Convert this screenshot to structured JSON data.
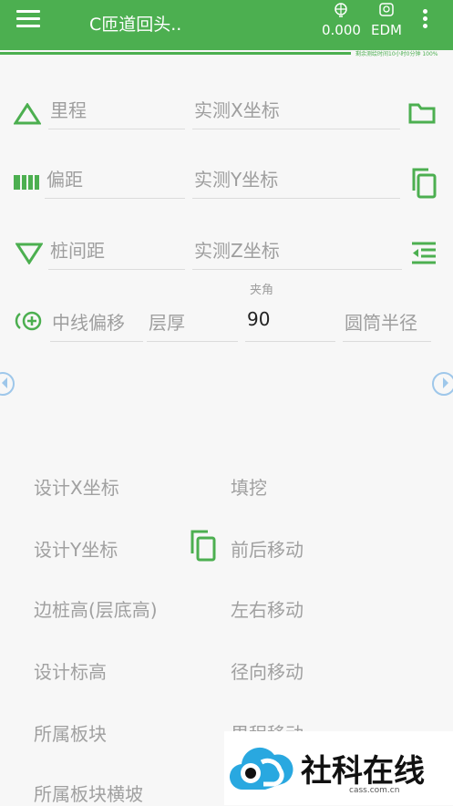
{
  "header": {
    "title": "C匝道回头..",
    "value": "0.000",
    "edm": "EDM",
    "remaining": "剩余测绘时间10小时0分钟 100%"
  },
  "inputs": {
    "mileage": "里程",
    "measured_x": "实测X坐标",
    "offset": "偏距",
    "measured_y": "实测Y坐标",
    "pile_spacing": "桩间距",
    "measured_z": "实测Z坐标",
    "centerline_offset": "中线偏移",
    "layer_thickness": "层厚",
    "angle_label": "夹角",
    "angle_value": "90",
    "cylinder_radius": "圆筒半径"
  },
  "results": {
    "design_x": "设计X坐标",
    "fill_cut": "填挖",
    "design_y": "设计Y坐标",
    "front_back": "前后移动",
    "edge_pile_height": "边桩高(层底高)",
    "left_right": "左右移动",
    "design_elevation": "设计标高",
    "radial": "径向移动",
    "plate": "所属板块",
    "mileage_move": "里程移动",
    "plate_slope": "所属板块横坡"
  },
  "watermark": {
    "text": "社科在线",
    "url": "cass.com.cn"
  },
  "colors": {
    "accent": "#4caf50",
    "nav": "#9ec7ea"
  }
}
